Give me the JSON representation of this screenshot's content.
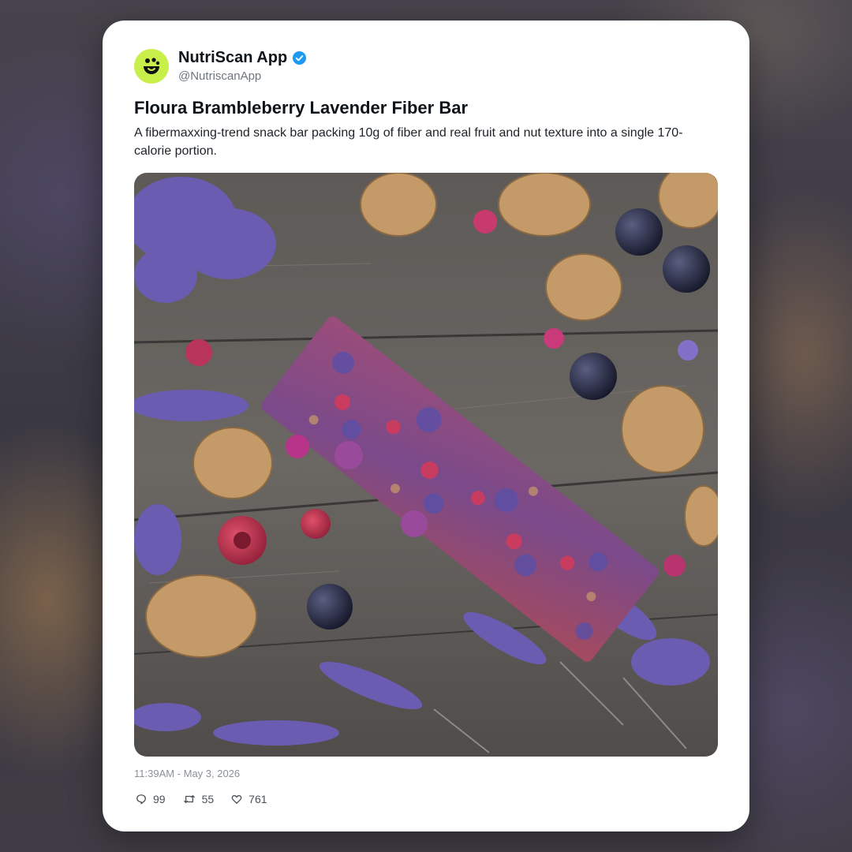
{
  "post": {
    "author_name": "NutriScan App",
    "author_handle": "@NutriscanApp",
    "title": "Floura Brambleberry Lavender Fiber Bar",
    "description": "A fibermaxxing-trend snack bar packing 10g of fiber and real fruit and nut texture into a single 170-calorie portion.",
    "timestamp": "11:39AM - May 3, 2026",
    "replies": "99",
    "reposts": "55",
    "likes": "761"
  },
  "icons": {
    "avatar": "nutriscan-logo-icon",
    "verified": "verified-badge-icon",
    "reply": "comment-icon",
    "repost": "repost-icon",
    "like": "heart-icon"
  },
  "colors": {
    "avatar_bg": "#c8ef4a",
    "verified": "#1d9bf0",
    "text": "#0f1419",
    "muted": "#6e767d"
  }
}
